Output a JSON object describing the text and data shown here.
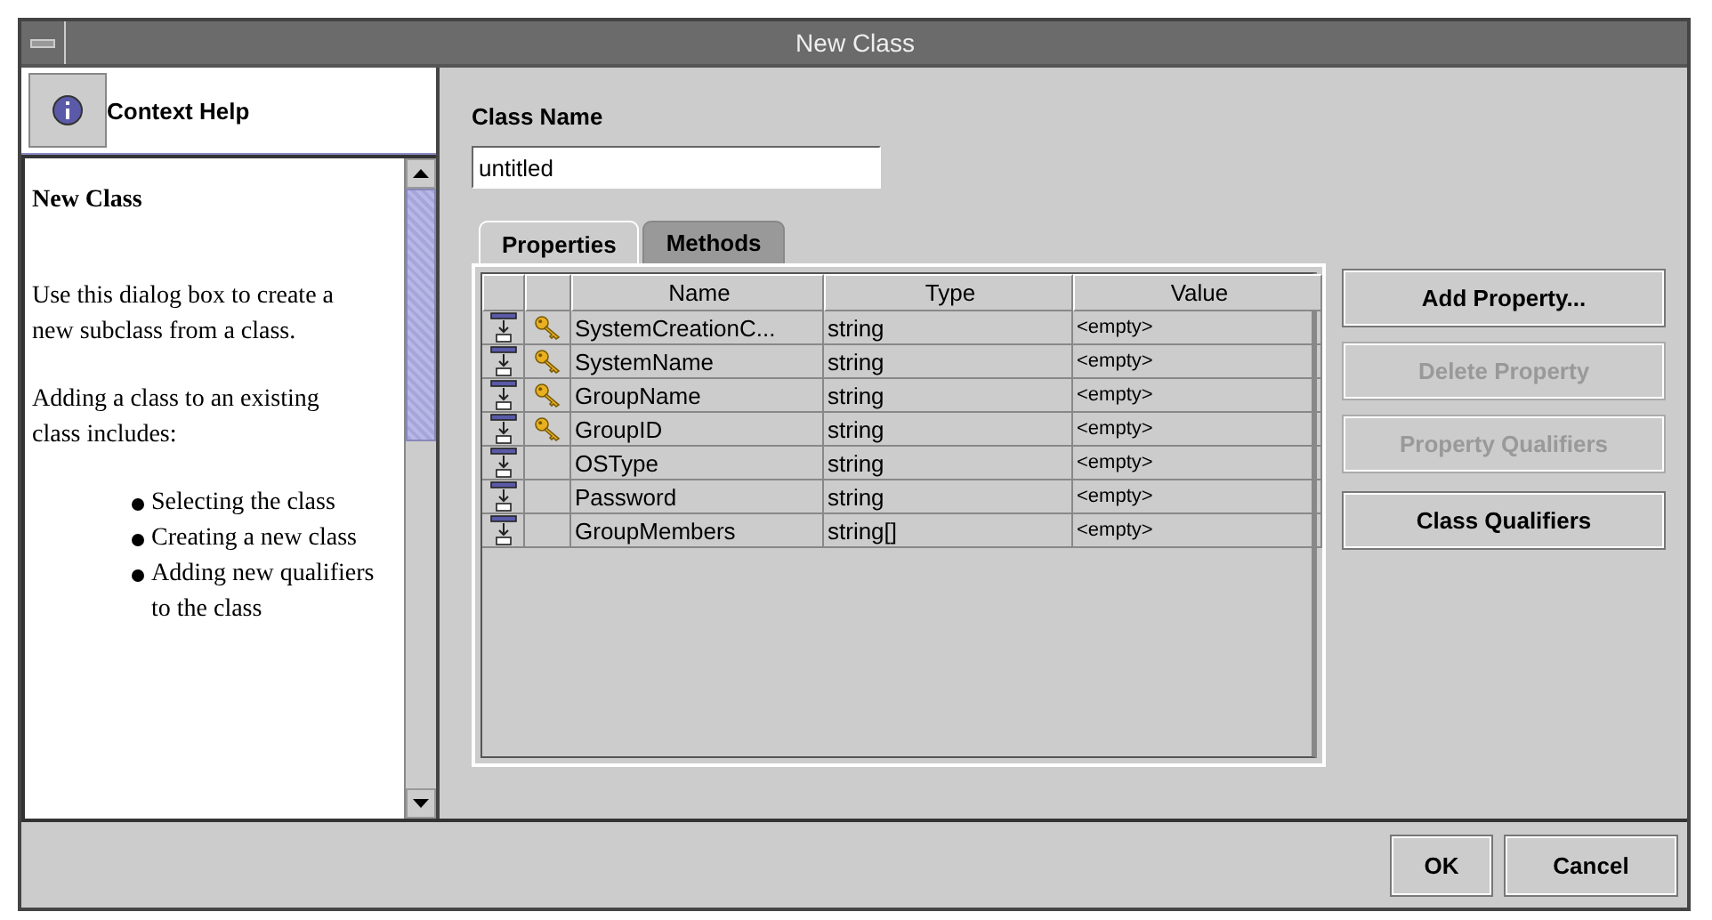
{
  "window": {
    "title": "New Class"
  },
  "help": {
    "header": "Context Help",
    "heading": "New Class",
    "paragraphs": [
      "Use this dialog box to create a new subclass from a class.",
      "Adding a class to an existing class includes:"
    ],
    "bullets": [
      "Selecting the class",
      "Creating a new class",
      "Adding new qualifiers to the class"
    ]
  },
  "class_name": {
    "label": "Class Name",
    "value": "untitled"
  },
  "tabs": [
    {
      "label": "Properties",
      "selected": true
    },
    {
      "label": "Methods",
      "selected": false
    }
  ],
  "table": {
    "columns": [
      "Name",
      "Type",
      "Value"
    ],
    "rows": [
      {
        "key": true,
        "name": "SystemCreationC...",
        "type": "string",
        "value": "<empty>"
      },
      {
        "key": true,
        "name": "SystemName",
        "type": "string",
        "value": "<empty>"
      },
      {
        "key": true,
        "name": "GroupName",
        "type": "string",
        "value": "<empty>"
      },
      {
        "key": true,
        "name": "GroupID",
        "type": "string",
        "value": "<empty>"
      },
      {
        "key": false,
        "name": "OSType",
        "type": "string",
        "value": "<empty>"
      },
      {
        "key": false,
        "name": "Password",
        "type": "string",
        "value": "<empty>"
      },
      {
        "key": false,
        "name": "GroupMembers",
        "type": "string[]",
        "value": "<empty>"
      }
    ]
  },
  "side_buttons": [
    {
      "label": "Add Property...",
      "disabled": false
    },
    {
      "label": "Delete Property",
      "disabled": true
    },
    {
      "label": "Property Qualifiers",
      "disabled": true
    },
    {
      "label": "Class Qualifiers",
      "disabled": false
    }
  ],
  "buttons": [
    "OK",
    "Cancel"
  ]
}
